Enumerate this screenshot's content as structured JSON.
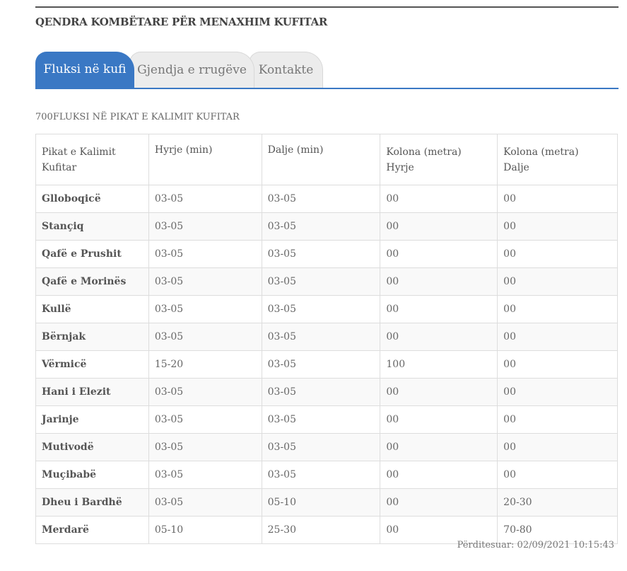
{
  "site": {
    "title": "QENDRA KOMBËTARE PËR MENAXHIM KUFITAR"
  },
  "tabs": [
    "Fluksi në kufi",
    "Gjendja e rrugëve",
    "Kontakte"
  ],
  "section": {
    "title": "700FLUKSI NË PIKAT E KALIMIT KUFITAR"
  },
  "table": {
    "headers": [
      [
        "Pikat e Kalimit",
        "Kufitar"
      ],
      [
        "Hyrje (min)",
        ""
      ],
      [
        "Dalje (min)",
        ""
      ],
      [
        "Kolona (metra)",
        "Hyrje"
      ],
      [
        "Kolona (metra)",
        "Dalje"
      ]
    ],
    "rows": [
      [
        "Glloboqicë",
        "03-05",
        "03-05",
        "00",
        "00"
      ],
      [
        "Stançiq",
        "03-05",
        "03-05",
        "00",
        "00"
      ],
      [
        "Qafë e Prushit",
        "03-05",
        "03-05",
        "00",
        "00"
      ],
      [
        "Qafë e Morinës",
        "03-05",
        "03-05",
        "00",
        "00"
      ],
      [
        "Kullë",
        "03-05",
        "03-05",
        "00",
        "00"
      ],
      [
        "Bërnjak",
        "03-05",
        "03-05",
        "00",
        "00"
      ],
      [
        "Vërmicë",
        "15-20",
        "03-05",
        "100",
        "00"
      ],
      [
        "Hani i Elezit",
        "03-05",
        "03-05",
        "00",
        "00"
      ],
      [
        "Jarinje",
        "03-05",
        "03-05",
        "00",
        "00"
      ],
      [
        "Mutivodë",
        "03-05",
        "03-05",
        "00",
        "00"
      ],
      [
        "Muçibabë",
        "03-05",
        "03-05",
        "00",
        "00"
      ],
      [
        "Dheu i Bardhë",
        "03-05",
        "05-10",
        "00",
        "20-30"
      ],
      [
        "Merdarë",
        "05-10",
        "25-30",
        "00",
        "70-80"
      ]
    ]
  },
  "updated": {
    "text": "Përditesuar: 02/09/2021 10:15:43"
  },
  "colors": {
    "accent": "#3a78c4",
    "tab_inactive": "#ececec"
  }
}
